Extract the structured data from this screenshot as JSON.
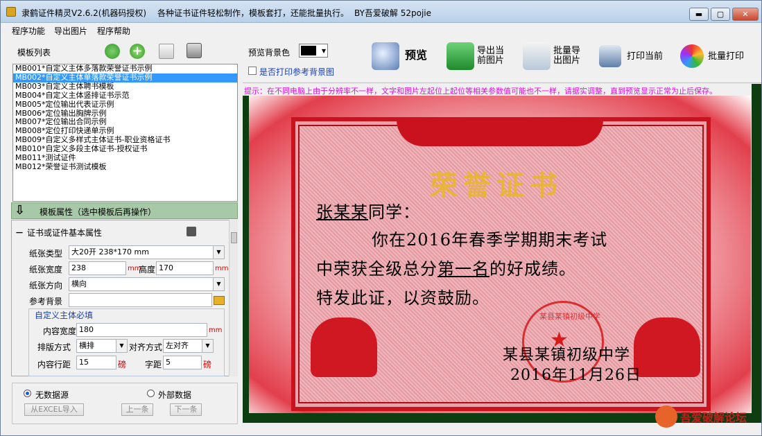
{
  "window": {
    "title": "隶鹤证件精灵V2.6.2(机器码授权)",
    "slogan": "各种证书证件轻松制作，模板套打，还能批量执行。",
    "credit": "BY吾爱破解 52pojie",
    "min_label": "▬",
    "max_label": "▢",
    "close_label": "✕"
  },
  "menu": [
    "程序功能",
    "导出图片",
    "程序帮助"
  ],
  "templates": {
    "header": "模板列表",
    "toolbar_icons": [
      "refresh-icon",
      "add-icon",
      "edit-icon",
      "trash-icon"
    ],
    "items": [
      "MB001*自定义主体多落款荣誉证书示例",
      "MB002*自定义主体单落款荣誉证书示例",
      "MB003*自定义主体聘书模板",
      "MB004*自定义主体竖排证书示范",
      "MB005*定位输出代表证示例",
      "MB006*定位输出胸牌示例",
      "MB007*定位输出合同示例",
      "MB008*定位打印快递单示例",
      "MB009*自定义多样式主体证书-职业资格证书",
      "MB010*自定义多段主体证书-授权证书",
      "MB011*测试证件",
      "MB012*荣誉证书测试模板"
    ],
    "selected_index": 1
  },
  "properties": {
    "bar_label": "模板属性（选中模板后再操作）",
    "section_title": "证书或证件基本属性",
    "collapse_symbol": "－",
    "paper_type_label": "纸张类型",
    "paper_type_value": "大20开 238*170 mm",
    "paper_width_label": "纸张宽度",
    "paper_width_value": "238",
    "mm": "mm",
    "height_label": "高度",
    "height_value": "170",
    "orientation_label": "纸张方向",
    "orientation_value": "横向",
    "ref_bg_label": "参考背景",
    "ref_bg_value": "",
    "group_title": "自定义主体必填",
    "content_width_label": "内容宽度",
    "content_width_value": "180",
    "layout_label": "排版方式",
    "layout_value": "横排",
    "align_label": "对齐方式",
    "align_value": "左对齐",
    "line_spacing_label": "内容行距",
    "line_spacing_value": "15",
    "pound": "磅",
    "char_spacing_label": "字距",
    "char_spacing_value": "5"
  },
  "datasource": {
    "no_source_label": "无数据源",
    "external_label": "外部数据",
    "import_excel": "从EXCEL导入",
    "prev": "上一条",
    "next": "下一条",
    "selected": "no_source"
  },
  "toolbar": {
    "preview_bg_label": "预览背景色",
    "preview_bg_color": "#000000",
    "print_ref_bg_label": "是否打印参考背景图",
    "preview_label": "预览",
    "export_current_line1": "导出当",
    "export_current_line2": "前图片",
    "batch_export_line1": "批量导",
    "batch_export_line2": "出图片",
    "print_current": "打印当前",
    "batch_print": "批量打印"
  },
  "hint": "提示：在不同电脑上由于分辨率不一样，文字和图片左起位上起位等相关参数值可能也不一样，请据实调整，直到预览显示正常为止后保存。",
  "certificate": {
    "title": "荣誉证书",
    "name": "张某某",
    "greeting_suffix": "同学：",
    "line1": "你在2016年春季学期期末考试",
    "line2_prefix": "中荣获全级总分",
    "line2_highlight": "第一名",
    "line2_suffix": "的好成绩。",
    "line3": "特发此证，以资鼓励。",
    "school": "某县某镇初级中学",
    "date": "2016年11月26日",
    "seal_text": "某县某镇初级中学"
  },
  "watermark": "吾爱破解论坛"
}
